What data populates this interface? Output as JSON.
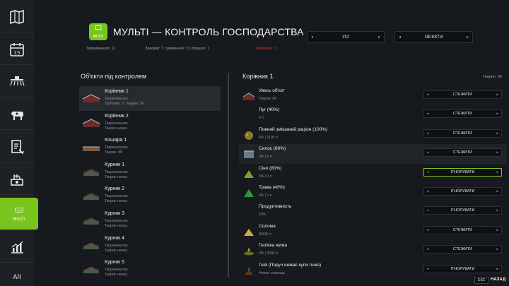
{
  "header": {
    "title": "МУЛЬТІ — КОНТРОЛЬ ГОСПОДАРСТВА",
    "icon_label": "MULTI",
    "stat_breeders": "Тваринництв: 11",
    "stat_factories": "Заводів: 7 | увімкнено: 3 | працює: 1",
    "stat_problems": "Проблем: 3",
    "dropdown_filter": "УСІ",
    "dropdown_view": "ОБ'ЄКТИ"
  },
  "sidebar": {
    "active_label": "MULTI",
    "icons": [
      "map-icon",
      "calendar-icon",
      "sprayer-icon",
      "animals-icon",
      "contracts-icon",
      "production-icon",
      "multi-icon",
      "statistics-icon",
      "help-icon"
    ]
  },
  "left_panel": {
    "title": "Об'єкти під контролем",
    "items": [
      {
        "name": "Корівник 1",
        "sub1": "Тваринництво",
        "sub2": "Проблем: 2 | Тварин: 96"
      },
      {
        "name": "Корівник 2",
        "sub1": "Тваринництво",
        "sub2": "Тварин немає"
      },
      {
        "name": "Кошара 1",
        "sub1": "Тваринництво",
        "sub2": "Тварин: 88"
      },
      {
        "name": "Курник 1",
        "sub1": "Тваринництво",
        "sub2": "Тварин немає"
      },
      {
        "name": "Курник 2",
        "sub1": "Тваринництво",
        "sub2": "Тварин немає"
      },
      {
        "name": "Курник 3",
        "sub1": "Тваринництво",
        "sub2": "Тварин немає"
      },
      {
        "name": "Курник 4",
        "sub1": "Тваринництво",
        "sub2": "Тварин немає"
      },
      {
        "name": "Курник 5",
        "sub1": "Тваринництво",
        "sub2": "Тварин немає"
      }
    ]
  },
  "right_panel": {
    "title": "Корівник 1",
    "count": "Тварин: 96",
    "rows": [
      {
        "name": "Увесь об'єкт",
        "sub": "Тварин: 96",
        "action": "СТЕЖИТИ",
        "icon": "barn-icon"
      },
      {
        "name": "Луг (40%)",
        "sub": "0 л",
        "action": "СТЕЖИТИ",
        "icon": ""
      },
      {
        "name": "Повний змішаний раціон (100%)",
        "sub": "4% | 2100 л",
        "action": "СТЕЖИТИ",
        "icon": "tmr-icon"
      },
      {
        "name": "Силос (80%)",
        "sub": "0% | 0 л",
        "action": "СТЕЖИТИ",
        "icon": "silage-icon"
      },
      {
        "name": "Сіно (80%)",
        "sub": "0% | 0 л",
        "action": "ІГНОРУВАТИ",
        "icon": "hay-icon"
      },
      {
        "name": "Трава (40%)",
        "sub": "0% | 0 л",
        "action": "ІГНОРУВАТИ",
        "icon": "grass-icon"
      },
      {
        "name": "Продуктивність",
        "sub": "20%",
        "action": "ІГНОРУВАТИ",
        "icon": ""
      },
      {
        "name": "Солома",
        "sub": "36110 л",
        "action": "СТЕЖИТИ",
        "icon": "straw-icon"
      },
      {
        "name": "Гноївка жижа",
        "sub": "0% | 3000 л",
        "action": "СТЕЖИТИ",
        "icon": "slurry-icon"
      },
      {
        "name": "Гній (Поруч немає купи гною)",
        "sub": "Немає сховища",
        "action": "ІГНОРУВАТИ",
        "icon": "manure-icon"
      }
    ]
  },
  "footer": {
    "esc": "ESC",
    "back": "НАЗАД"
  },
  "colors": {
    "accent": "#7ac51d",
    "problem": "#e0302a",
    "background": "#161a1e"
  }
}
